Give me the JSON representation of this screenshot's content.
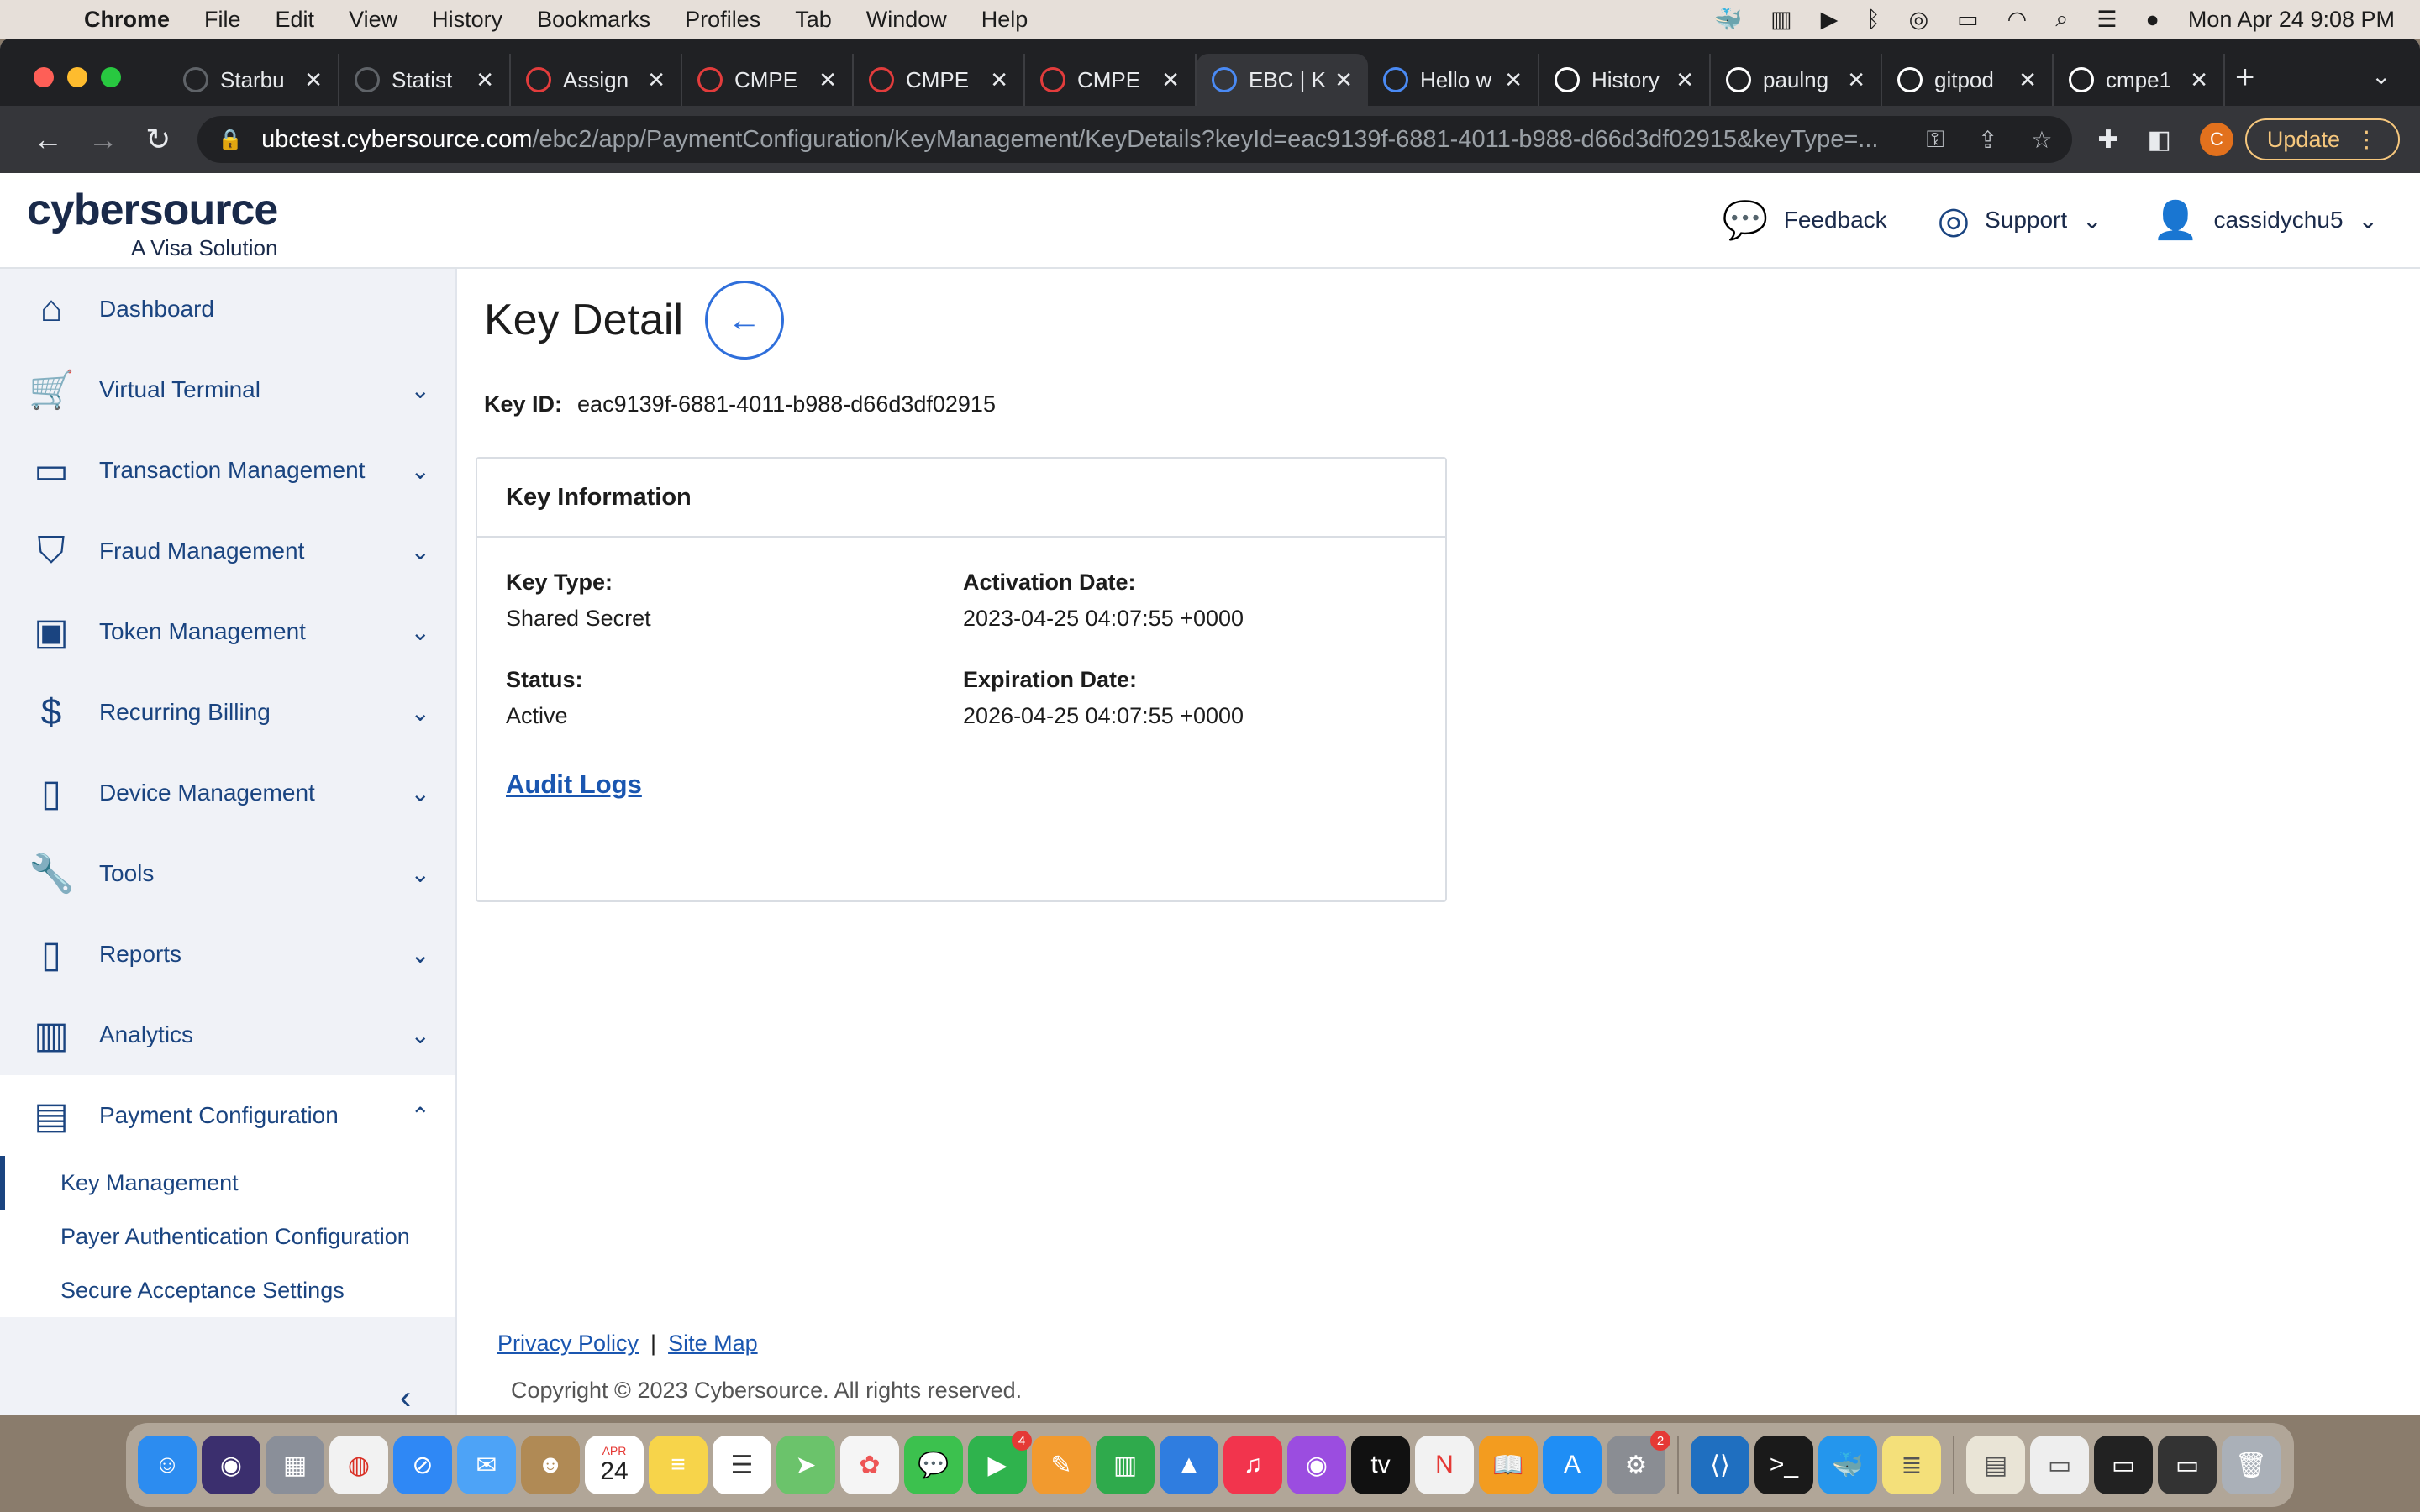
{
  "menubar": {
    "app": "Chrome",
    "items": [
      "File",
      "Edit",
      "View",
      "History",
      "Bookmarks",
      "Profiles",
      "Tab",
      "Window",
      "Help"
    ],
    "datetime": "Mon Apr 24  9:08 PM"
  },
  "tabs": [
    {
      "label": "Starbu",
      "icon": "globe-icon",
      "color": "#5f6368"
    },
    {
      "label": "Statist",
      "icon": "globe-icon",
      "color": "#5f6368"
    },
    {
      "label": "Assign",
      "icon": "canvas-icon",
      "color": "#e23c3c"
    },
    {
      "label": "CMPE",
      "icon": "canvas-icon",
      "color": "#e23c3c"
    },
    {
      "label": "CMPE",
      "icon": "canvas-icon",
      "color": "#e23c3c"
    },
    {
      "label": "CMPE",
      "icon": "canvas-icon",
      "color": "#e23c3c"
    },
    {
      "label": "EBC | K",
      "icon": "loading-icon",
      "color": "#4a8af4"
    },
    {
      "label": "Hello w",
      "icon": "loading-icon",
      "color": "#4a8af4"
    },
    {
      "label": "History",
      "icon": "github-icon",
      "color": "#ffffff"
    },
    {
      "label": "paulng",
      "icon": "github-icon",
      "color": "#ffffff"
    },
    {
      "label": "gitpod",
      "icon": "github-icon",
      "color": "#ffffff"
    },
    {
      "label": "cmpe1",
      "icon": "github-icon",
      "color": "#ffffff"
    }
  ],
  "address": {
    "host": "ubctest.cybersource.com",
    "path": "/ebc2/app/PaymentConfiguration/KeyManagement/KeyDetails?keyId=eac9139f-6881-4011-b988-d66d3df02915&keyType=..."
  },
  "toolbar": {
    "profile_initial": "C",
    "update_label": "Update"
  },
  "header": {
    "brand": "cybersource",
    "tagline": "A Visa Solution",
    "feedback": "Feedback",
    "support": "Support",
    "user": "cassidychu5"
  },
  "sidebar": {
    "items": [
      {
        "label": "Dashboard",
        "icon": "home-icon",
        "glyph": "⌂"
      },
      {
        "label": "Virtual Terminal",
        "icon": "cart-icon",
        "glyph": "🛒"
      },
      {
        "label": "Transaction Management",
        "icon": "cards-icon",
        "glyph": "▭"
      },
      {
        "label": "Fraud Management",
        "icon": "shield-icon",
        "glyph": "⛉"
      },
      {
        "label": "Token Management",
        "icon": "vault-icon",
        "glyph": "▣"
      },
      {
        "label": "Recurring Billing",
        "icon": "dollar-doc-icon",
        "glyph": "$"
      },
      {
        "label": "Device Management",
        "icon": "device-icon",
        "glyph": "▯"
      },
      {
        "label": "Tools",
        "icon": "wrench-icon",
        "glyph": "🔧"
      },
      {
        "label": "Reports",
        "icon": "document-icon",
        "glyph": "▯"
      },
      {
        "label": "Analytics",
        "icon": "bar-chart-icon",
        "glyph": "▥"
      }
    ],
    "expanded": {
      "label": "Payment Configuration",
      "icon": "payment-config-icon",
      "glyph": "▤"
    },
    "sub_items": [
      "Key Management",
      "Payer Authentication Configuration",
      "Secure Acceptance Settings"
    ]
  },
  "main": {
    "title": "Key Detail",
    "key_id_label": "Key ID:",
    "key_id": "eac9139f-6881-4011-b988-d66d3df02915",
    "card_title": "Key Information",
    "key_type_label": "Key Type:",
    "key_type": "Shared Secret",
    "activation_label": "Activation Date:",
    "activation": "2023-04-25 04:07:55 +0000",
    "status_label": "Status:",
    "status": "Active",
    "expiration_label": "Expiration Date:",
    "expiration": "2026-04-25 04:07:55 +0000",
    "audit_logs": "Audit Logs"
  },
  "footer": {
    "privacy": "Privacy Policy",
    "separator": "|",
    "sitemap": "Site Map",
    "copyright": "Copyright © 2023 Cybersource. All rights reserved."
  },
  "dock": {
    "calendar_month": "APR",
    "calendar_day": "24",
    "facetime_badge": "4",
    "settings_badge": "2"
  }
}
